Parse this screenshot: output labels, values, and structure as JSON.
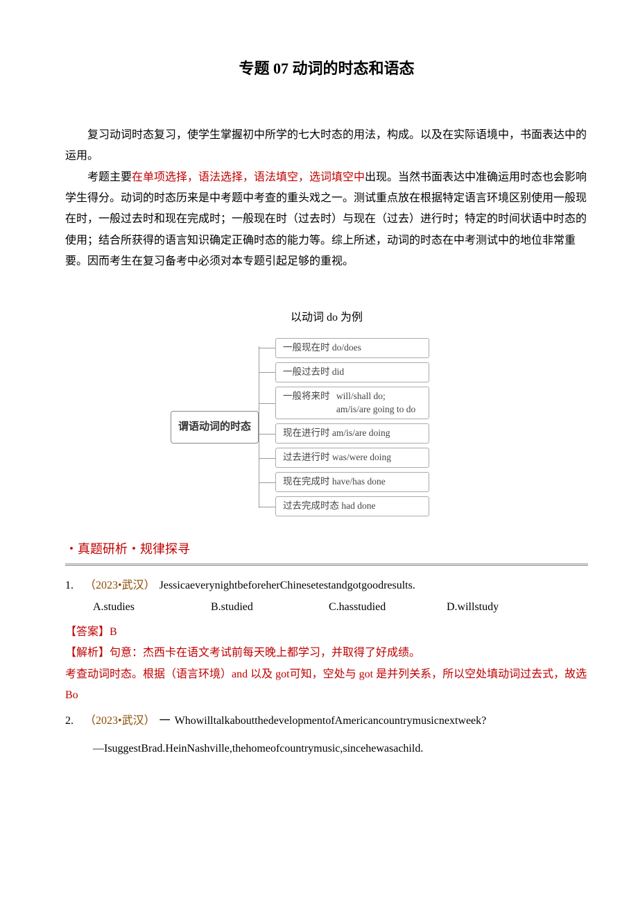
{
  "title": "专题 07 动词的时态和语态",
  "intro": {
    "p1_prefix": "复习动词时态复习，使学生掌握初中所学的七大时态的用法，构成。以及在实际语境中，书面表达中的运用。",
    "p2_a": "考题主要",
    "p2_red": "在单项选择，语法选择，语法填空，选词填空中",
    "p2_b": "出现。当然书面表达中准确运用时态也会影响学生得分。动词的时态历来是中考题中考查的重头戏之一。测试重点放在根据特定语言环境区别使用一般现在时，一般过去时和现在完成时；一般现在时（过去时）与现在（过去）进行时；特定的时间状语中时态的使用；结合所获得的语言知识确定正确时态的能力等。综上所述，动词的时态在中考测试中的地位非常重要。因而考生在复习备考中必须对本专题引起足够的重视。"
  },
  "diagram": {
    "caption": "以动词 do 为例",
    "root": "谓语动词的时态",
    "leaves": [
      {
        "l1": "一般现在时  do/does"
      },
      {
        "l1": "一般过去时  did"
      },
      {
        "l1": "一般将来时",
        "l2a": "will/shall do;",
        "l2b": "am/is/are going to do"
      },
      {
        "l1": "现在进行时  am/is/are doing"
      },
      {
        "l1": "过去进行时  was/were doing"
      },
      {
        "l1": "现在完成时  have/has done"
      },
      {
        "l1": "过去完成时态  had done"
      }
    ]
  },
  "section_title": "・真题研析・规律探寻",
  "q1": {
    "num": "1.",
    "tag": "（2023•武汉）",
    "stem": "JessicaeverynightbeforeherChinesetestandgotgoodresults.",
    "optA": "A.studies",
    "optB": "B.studied",
    "optC": "C.hasstudied",
    "optD": "D.willstudy"
  },
  "q1_answer": {
    "ans_label": "【答案】",
    "ans_val": "B",
    "exp_label": "【解析】",
    "exp_l1": "句意：杰西卡在语文考试前每天晚上都学习，并取得了好成绩。",
    "exp_l2a": "考查动词时态。根据（语言环境）",
    "exp_l2_and": "and",
    "exp_l2b": " 以及 ",
    "exp_l2_got": "got",
    "exp_l2c": "可知，空处与 ",
    "exp_l2_got2": "got",
    "exp_l2d": " 是并列关系，所以空处填动词过去式，故选",
    "exp_l3": "Bo"
  },
  "q2": {
    "num": "2.",
    "tag": "（2023•武汉）",
    "dash": "一",
    "stem1": "WhowilltalkaboutthedevelopmentofAmericancountrymusicnextweek?",
    "stem2_dash": "—",
    "stem2": "IsuggestBrad.HeinNashville,thehomeofcountrymusic,sincehewasachild."
  }
}
